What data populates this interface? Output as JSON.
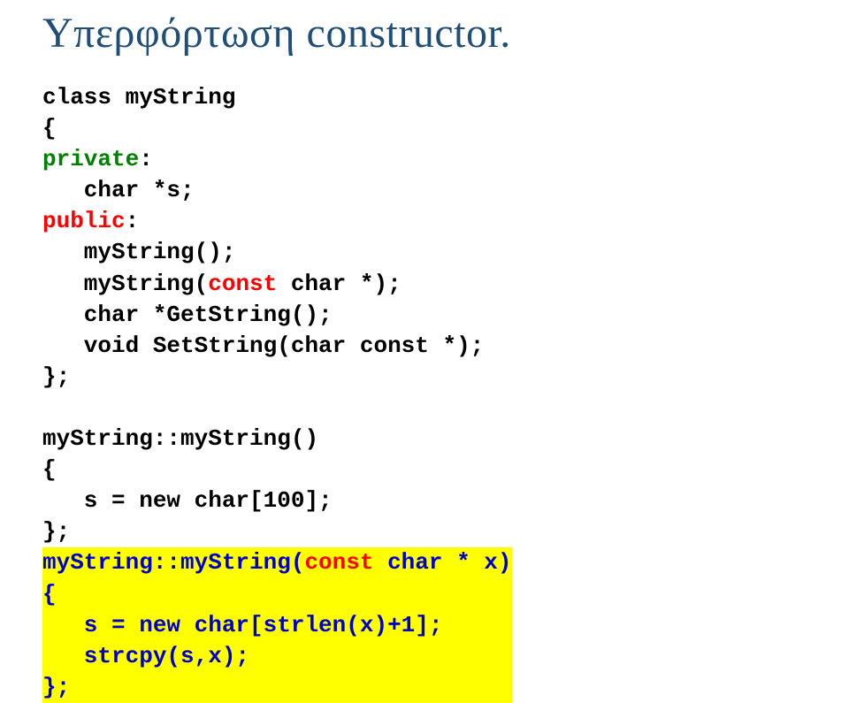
{
  "title": "Υπερφόρτωση constructor.",
  "code": {
    "l1": "class myString",
    "l2": "{",
    "l3a": "private",
    "l3b": ":",
    "l4": "   char *s;",
    "l5a": "public",
    "l5b": ":",
    "l6": "   myString();",
    "l7a": "   myString(",
    "l7b": "const",
    "l7c": " char *);",
    "l8": "   char *GetString();",
    "l9": "   void SetString(char const *);",
    "l10": "};",
    "l11": "",
    "l12": "myString::myString()",
    "l13": "{",
    "l14": "   s = new char[100];",
    "l15": "};",
    "y1a": "myString::myString(",
    "y1b": "const",
    "y1c": " char * x)",
    "y2": "{",
    "y3": "   s = new char[strlen(x)+1];",
    "y4": "   strcpy(s,x);",
    "y5": "};"
  }
}
